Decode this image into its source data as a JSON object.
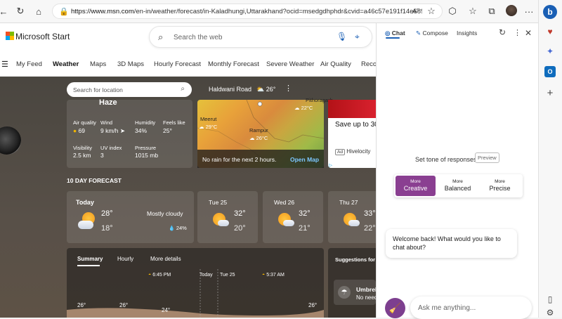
{
  "browser": {
    "url_prefix": "https://www.msn.com",
    "url_rest": "/en-in/weather/forecast/in-Kaladhungi,Uttarakhand?ocid=msedgdhphdr&cvid=a46c57e191f14e689f24acf...",
    "read_aloud": "Aᵀ"
  },
  "msn": {
    "brand": "Microsoft Start",
    "search_placeholder": "Search the web"
  },
  "nav": [
    "My Feed",
    "Weather",
    "Maps",
    "3D Maps",
    "Hourly Forecast",
    "Monthly Forecast",
    "Severe Weather",
    "Air Quality",
    "Recor"
  ],
  "location_bar": {
    "placeholder": "Search for location",
    "location": "Haldwani Road",
    "temp": "26°"
  },
  "current": {
    "condition": "Haze",
    "metrics": [
      {
        "label": "Air quality",
        "value": "69"
      },
      {
        "label": "Wind",
        "value": "9 km/h"
      },
      {
        "label": "Humidity",
        "value": "34%"
      },
      {
        "label": "Feels like",
        "value": "25°"
      },
      {
        "label": "Visibility",
        "value": "2.5 km"
      },
      {
        "label": "UV index",
        "value": "3"
      },
      {
        "label": "Pressure",
        "value": "1015 mb"
      }
    ]
  },
  "map": {
    "labels": [
      {
        "name": "Pithoragarh",
        "temp": "22°C"
      },
      {
        "name": "Meerut",
        "temp": "29°C"
      },
      {
        "name": "Rampur",
        "temp": "26°C"
      }
    ],
    "footer": "No rain for the next 2 hours.",
    "link": "Open Map"
  },
  "ad": {
    "headline": "Save up to 30",
    "sponsor": "Hivelocity",
    "choices": "AdChoices"
  },
  "forecast": {
    "title": "10 DAY FORECAST",
    "days": [
      {
        "day": "Today",
        "high": "28°",
        "low": "18°",
        "desc": "Mostly cloudy",
        "precip": "24%"
      },
      {
        "day": "Tue 25",
        "high": "32°",
        "low": "20°"
      },
      {
        "day": "Wed 26",
        "high": "32°",
        "low": "21°"
      },
      {
        "day": "Thu 27",
        "high": "33°",
        "low": "22°"
      }
    ]
  },
  "detail": {
    "tabs": [
      "Summary",
      "Hourly",
      "More details"
    ],
    "sunset": "6:45 PM",
    "today": "Today",
    "tue": "Tue 25",
    "sunrise": "5:37 AM",
    "temps": [
      "26°",
      "26°",
      "24°",
      "26°"
    ]
  },
  "suggestions": {
    "title": "Suggestions for y",
    "item_title": "Umbrel",
    "item_sub": "No need"
  },
  "sidebar": {
    "tabs": [
      "Chat",
      "Compose",
      "Insights"
    ],
    "tone_label": "Set tone of responses",
    "preview": "Preview",
    "tones": [
      {
        "small": "More",
        "large": "Creative"
      },
      {
        "small": "More",
        "large": "Balanced"
      },
      {
        "small": "More",
        "large": "Precise"
      }
    ],
    "welcome": "Welcome back! What would you like to chat about?",
    "ask_placeholder": "Ask me anything..."
  },
  "colors": {
    "creative": "#8a3f91",
    "accent": "#1a5fb4"
  }
}
